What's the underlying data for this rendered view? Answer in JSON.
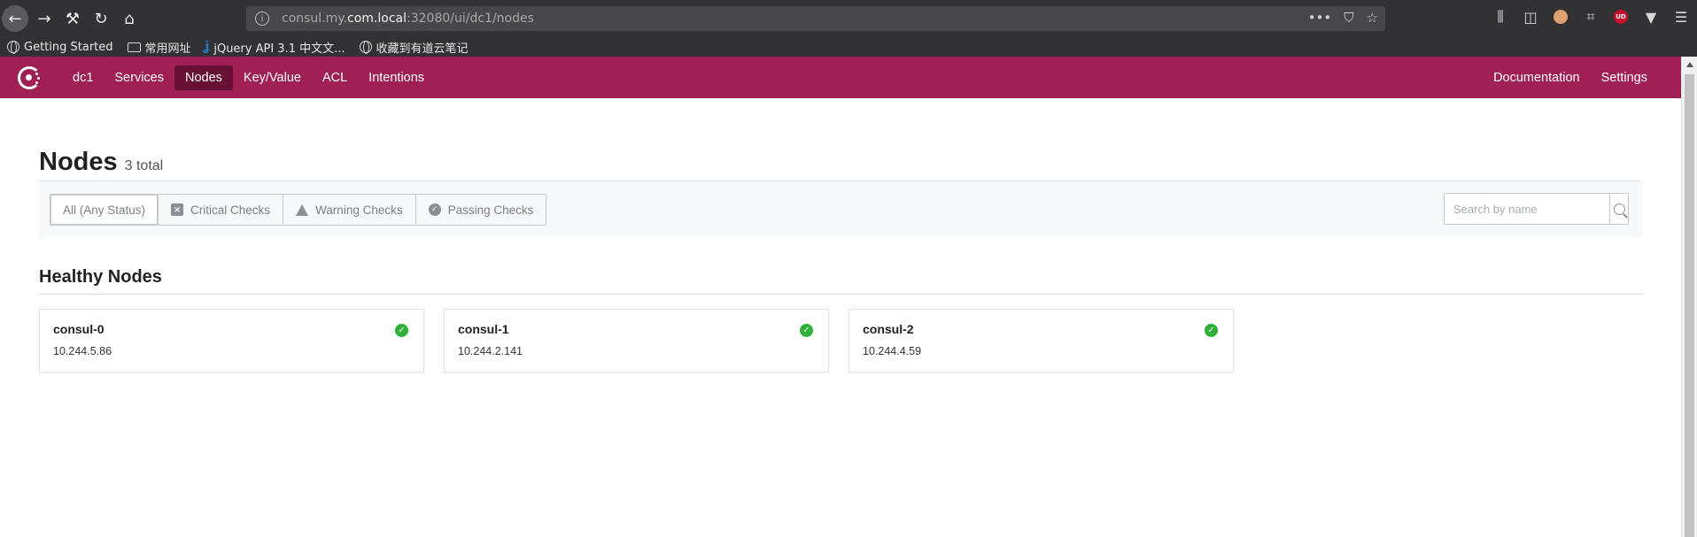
{
  "browser": {
    "url_prefix": "consul.my.",
    "url_host": "com.local",
    "url_suffix": ":32080/ui/dc1/nodes",
    "bookmarks": [
      "Getting Started",
      "常用网址",
      "jQuery API 3.1 中文文...",
      "收藏到有道云笔记"
    ]
  },
  "nav": {
    "datacenter": "dc1",
    "items": [
      "Services",
      "Nodes",
      "Key/Value",
      "ACL",
      "Intentions"
    ],
    "active": "Nodes",
    "right_items": [
      "Documentation",
      "Settings"
    ],
    "brand_color": "#a01f55"
  },
  "page": {
    "title": "Nodes",
    "total": "3 total"
  },
  "filters": {
    "buttons": [
      "All (Any Status)",
      "Critical Checks",
      "Warning Checks",
      "Passing Checks"
    ],
    "search_placeholder": "Search by name"
  },
  "section": {
    "title": "Healthy Nodes"
  },
  "nodes": [
    {
      "name": "consul-0",
      "ip": "10.244.5.86",
      "status": "passing"
    },
    {
      "name": "consul-1",
      "ip": "10.244.2.141",
      "status": "passing"
    },
    {
      "name": "consul-2",
      "ip": "10.244.4.59",
      "status": "passing"
    }
  ]
}
